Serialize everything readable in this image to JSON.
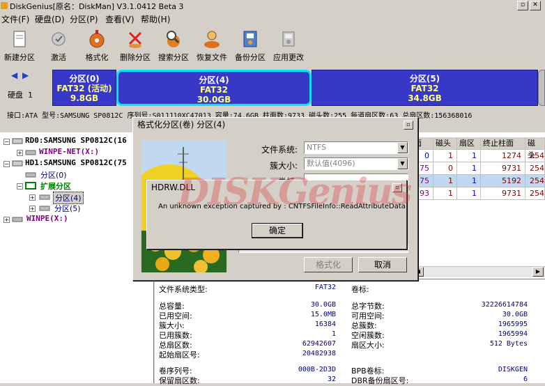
{
  "window": {
    "title": "DiskGenius[原名：DiskMan] V3.1.0412 Beta 3"
  },
  "menu": [
    "文件(F)",
    "硬盘(D)",
    "分区(P)",
    "查看(V)",
    "帮助(H)"
  ],
  "toolbar": [
    {
      "label": "新建分区",
      "icon": "new-partition-icon"
    },
    {
      "label": "激活",
      "icon": "activate-icon"
    },
    {
      "label": "格式化",
      "icon": "format-icon"
    },
    {
      "label": "删除分区",
      "icon": "delete-partition-icon"
    },
    {
      "label": "搜索分区",
      "icon": "search-partition-icon"
    },
    {
      "label": "恢复文件",
      "icon": "recover-file-icon"
    },
    {
      "label": "备份分区",
      "icon": "backup-partition-icon"
    },
    {
      "label": "应用更改",
      "icon": "apply-changes-icon"
    }
  ],
  "disk": {
    "label_line1": "硬盘",
    "label_line2": "1",
    "partitions": [
      {
        "name": "分区(0)",
        "fs": "FAT32 (活动)",
        "size": "9.8GB"
      },
      {
        "name": "分区(4)",
        "fs": "FAT32",
        "size": "30.0GB"
      },
      {
        "name": "分区(5)",
        "fs": "FAT32",
        "size": "34.8GB"
      }
    ],
    "info": "接口:ATA  型号:SAMSUNG SP0812C  序列号:S01JJ10XC47013  容量:74.6GB  柱面数:9733  磁头数:255  每道扇区数:63  总扇区数:156368016"
  },
  "tree": [
    {
      "label": "RD0:SAMSUNG SP0812C(16",
      "color": "#000000"
    },
    {
      "label": "WINPE-NET(X:)",
      "color": "#800080"
    },
    {
      "label": "HD1:SAMSUNG SP0812C(75",
      "color": "#000000"
    },
    {
      "label": "分区(0)",
      "color": "#000080"
    },
    {
      "label": "扩展分区",
      "color": "#008000"
    },
    {
      "label": "分区(4)",
      "color": "#000080"
    },
    {
      "label": "分区(5)",
      "color": "#000080"
    },
    {
      "label": "WINPE(X:)",
      "color": "#800080"
    }
  ],
  "grid": {
    "headers": [
      "面",
      "磁头",
      "扇区",
      "终止柱面",
      "磁头"
    ],
    "rows": [
      [
        "0",
        "1",
        "1",
        "1274",
        "254"
      ],
      [
        "75",
        "0",
        "1",
        "9731",
        "254"
      ],
      [
        "75",
        "1",
        "1",
        "5192",
        "254"
      ],
      [
        "93",
        "1",
        "1",
        "9731",
        "254"
      ]
    ]
  },
  "props": {
    "fs_type_label": "文件系统类型:",
    "fs_type_value": "FAT32",
    "volume_label": "卷标:",
    "left": [
      {
        "label": "总容量:",
        "value": "30.0GB"
      },
      {
        "label": "已用空间:",
        "value": "15.0MB"
      },
      {
        "label": "簇大小:",
        "value": "16384"
      },
      {
        "label": "已用簇数:",
        "value": "1"
      },
      {
        "label": "总扇区数:",
        "value": "62942607"
      },
      {
        "label": "起始扇区号:",
        "value": "20482938"
      }
    ],
    "right": [
      {
        "label": "总字节数:",
        "value": "32226614784"
      },
      {
        "label": "可用空间:",
        "value": "30.0GB"
      },
      {
        "label": "总簇数:",
        "value": "1965995"
      },
      {
        "label": "空闲簇数:",
        "value": "1965994"
      },
      {
        "label": "扇区大小:",
        "value": "512 Bytes"
      }
    ],
    "bottom_left": [
      {
        "label": "卷序列号:",
        "value": "000B-2D3D"
      },
      {
        "label": "保留扇区数:",
        "value": "32"
      }
    ],
    "bottom_right": [
      {
        "label": "BPB卷标:",
        "value": "DISKGEN"
      },
      {
        "label": "DBR备份扇区号:",
        "value": "6"
      }
    ]
  },
  "format_dialog": {
    "title": "格式化分区(卷) 分区(4)",
    "fs_label": "文件系统:",
    "fs_value": "NTFS",
    "cluster_label": "簇大小:",
    "cluster_value": "默认值(4096)",
    "volume_label": "卷标:",
    "format_button": "格式化",
    "cancel_button": "取消"
  },
  "error_dialog": {
    "title": "HDRW.DLL",
    "message": "An unknown exception captured by : CNTFSFileInfo::ReadAttributeData",
    "ok_button": "确定"
  },
  "watermark": "DISKGenius",
  "colors": {
    "partition_fill": "#3030c8",
    "selected_border": "#00e0ff",
    "accent": "#000080"
  }
}
